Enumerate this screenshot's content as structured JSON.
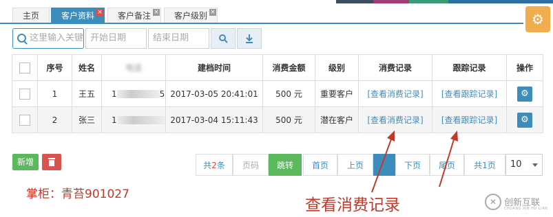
{
  "top_strip_colors": [
    "#3d4f5e",
    "#a23b74",
    "#3c9a78",
    "#2d6fa3"
  ],
  "tabs": [
    {
      "label": "主页",
      "closable": false,
      "active": false
    },
    {
      "label": "客户资料",
      "closable": true,
      "active": true
    },
    {
      "label": "客户备注",
      "closable": true,
      "active": false
    },
    {
      "label": "客户级别",
      "closable": true,
      "active": false
    }
  ],
  "tab_close_glyph": "×",
  "settings_icon": "gear-icon",
  "toolbar": {
    "search_placeholder": "这里输入关键",
    "start_date_placeholder": "开始日期",
    "end_date_placeholder": "结束日期",
    "search_button_icon": "search-icon",
    "export_button_icon": "download-icon"
  },
  "table": {
    "headers": [
      "",
      "序号",
      "姓名",
      "电话",
      "建档时间",
      "消费金额",
      "级别",
      "消费记录",
      "跟踪记录",
      "操作"
    ],
    "rows": [
      {
        "index": "1",
        "name": "王五",
        "phone_prefix": "1",
        "phone_suffix": "55",
        "created": "2017-03-05 20:41:01",
        "amount": "500 元",
        "level": "重要客户",
        "consume_link": "[查看消费记录]",
        "track_link": "[查看跟踪记录]"
      },
      {
        "index": "2",
        "name": "张三",
        "phone_prefix": "1",
        "phone_suffix": "",
        "created": "2017-03-04 15:11:43",
        "amount": "500 元",
        "level": "潜在客户",
        "consume_link": "[查看消费记录]",
        "track_link": "[查看跟踪记录]"
      }
    ],
    "op_icon": "gear-icon"
  },
  "buttons": {
    "add": "新增",
    "delete_icon": "trash-icon"
  },
  "pager": {
    "total_prefix": "共",
    "total_count": "2",
    "total_suffix": "条",
    "page_input_placeholder": "页码",
    "jump": "跳转",
    "first": "首页",
    "prev": "上页",
    "current": "1",
    "next": "下页",
    "last": "尾页",
    "pages_text": "共1页",
    "page_size": "10"
  },
  "annotations": {
    "shopkeeper": "掌柜：青苔901027",
    "callout": "查看消费记录"
  },
  "watermark": {
    "logo_glyph": "✕",
    "name": "创新互联",
    "sub": "CHUANG XIN HU LIAN"
  },
  "colors": {
    "accent": "#3c8dbc",
    "success": "#5cb85c",
    "danger": "#d9534f",
    "warning": "#f0ad4e",
    "annotation_red": "#c0392b"
  }
}
